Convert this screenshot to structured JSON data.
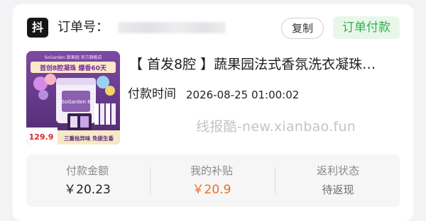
{
  "header": {
    "platform_logo_text": "抖",
    "order_label": "订单号：",
    "copy_label": "复制",
    "payment_status": "订单付款"
  },
  "product": {
    "title": "【 首发8腔 】蔬果园法式香氛洗衣凝珠…",
    "pay_time_label": "付款时间",
    "pay_time_value": "2026-08-25 01:00:02",
    "image": {
      "brand_text": "SoGarden 蔬果园 官方旗舰店",
      "banner_text": "首创8腔凝珠 爆香60天",
      "jar_label": "SoGarden 8",
      "price_text": "129.9",
      "bottom_text": "三重祛异味 免搓生香"
    }
  },
  "watermark": "线报酷-new.xianbao.fun",
  "stats": {
    "paid_amount_label": "付款金额",
    "paid_amount_value": "￥20.23",
    "my_subsidy_label": "我的补贴",
    "my_subsidy_value": "￥20.9",
    "rebate_status_label": "返利状态",
    "rebate_status_value": "待返现"
  },
  "colors": {
    "accent_green": "#2bb24c",
    "subsidy_orange": "#f26b1d",
    "product_purple": "#6b3e8e"
  }
}
